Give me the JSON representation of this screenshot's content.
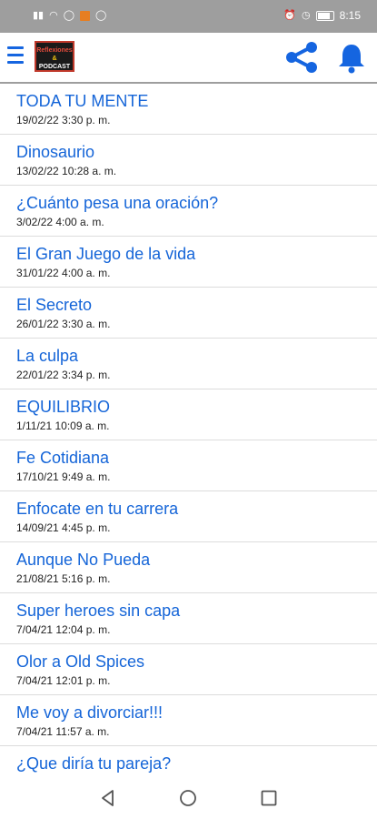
{
  "status_bar": {
    "time": "8:15",
    "left_icons": [
      "signal-icon",
      "wifi-icon",
      "whatsapp-icon",
      "notification-icon",
      "whatsapp-icon"
    ],
    "right_icons": [
      "alarm-icon",
      "clock-icon",
      "battery-icon"
    ]
  },
  "app_bar": {
    "logo_lines": [
      "Reflexiones",
      "&",
      "PODCAST"
    ],
    "icons": [
      "menu-icon",
      "share-icon",
      "bell-icon"
    ],
    "accent_color": "#1565e0"
  },
  "episodes": [
    {
      "title": "TODA TU MENTE",
      "date": "19/02/22 3:30 p. m."
    },
    {
      "title": "Dinosaurio",
      "date": "13/02/22 10:28 a. m."
    },
    {
      "title": "¿Cuánto pesa una oración?",
      "date": "3/02/22 4:00 a. m."
    },
    {
      "title": "El Gran Juego de la vida",
      "date": "31/01/22 4:00 a. m."
    },
    {
      "title": "El Secreto",
      "date": "26/01/22 3:30 a. m."
    },
    {
      "title": "La culpa",
      "date": "22/01/22 3:34 p. m."
    },
    {
      "title": "EQUILIBRIO",
      "date": "1/11/21 10:09 a. m."
    },
    {
      "title": "Fe Cotidiana",
      "date": "17/10/21 9:49 a. m."
    },
    {
      "title": "Enfocate en tu carrera",
      "date": "14/09/21 4:45 p. m."
    },
    {
      "title": "Aunque No Pueda",
      "date": "21/08/21 5:16 p. m."
    },
    {
      "title": "Super heroes sin capa",
      "date": "7/04/21 12:04 p. m."
    },
    {
      "title": "Olor a Old Spices",
      "date": "7/04/21 12:01 p. m."
    },
    {
      "title": "Me voy a divorciar!!!",
      "date": "7/04/21 11:57 a. m."
    },
    {
      "title": "¿Que diría tu pareja?",
      "date": ""
    }
  ],
  "nav_bar": {
    "icons": [
      "back-icon",
      "home-icon",
      "recent-apps-icon"
    ]
  }
}
